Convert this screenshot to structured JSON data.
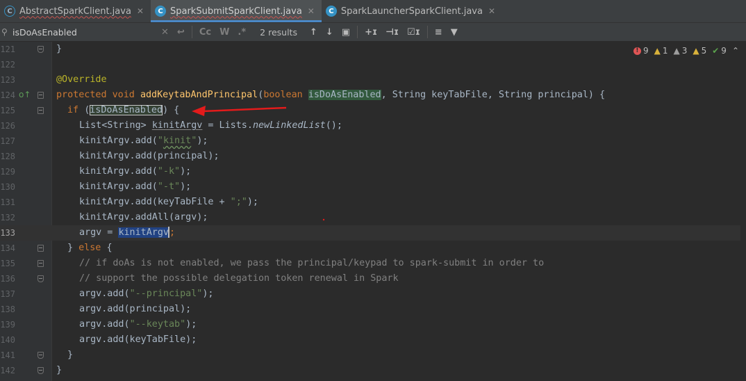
{
  "tabs": [
    {
      "label": "AbstractSparkClient.java",
      "icon": "abstract-class-icon",
      "icon_glyph": "C",
      "active": false
    },
    {
      "label": "SparkSubmitSparkClient.java",
      "icon": "class-icon",
      "icon_glyph": "C",
      "active": true
    },
    {
      "label": "SparkLauncherSparkClient.java",
      "icon": "class-icon",
      "icon_glyph": "C",
      "active": false
    }
  ],
  "search": {
    "value": "isDoAsEnabled",
    "results": "2 results",
    "case_label": "Cc",
    "words_label": "W",
    "regex_label": ".*"
  },
  "indicators": {
    "errors": "9",
    "warnings": "1",
    "weak_warnings": "3",
    "server_problems": "5",
    "typos": "9"
  },
  "code_lines": [
    {
      "num": "121",
      "text": "}"
    },
    {
      "num": "122",
      "text": ""
    },
    {
      "num": "123",
      "text": "@Override"
    },
    {
      "num": "124",
      "text": "protected void addKeytabAndPrincipal(boolean isDoAsEnabled, String keyTabFile, String principal) {"
    },
    {
      "num": "125",
      "text": "if (isDoAsEnabled) {"
    },
    {
      "num": "126",
      "text": "List<String> kinitArgv = Lists.newLinkedList();"
    },
    {
      "num": "127",
      "text": "kinitArgv.add(\"kinit\");"
    },
    {
      "num": "128",
      "text": "kinitArgv.add(principal);"
    },
    {
      "num": "129",
      "text": "kinitArgv.add(\"-k\");"
    },
    {
      "num": "130",
      "text": "kinitArgv.add(\"-t\");"
    },
    {
      "num": "131",
      "text": "kinitArgv.add(keyTabFile + \";\");"
    },
    {
      "num": "132",
      "text": "kinitArgv.addAll(argv);"
    },
    {
      "num": "133",
      "text": "argv = kinitArgv;"
    },
    {
      "num": "134",
      "text": "} else {"
    },
    {
      "num": "135",
      "text": "// if doAs is not enabled, we pass the principal/keypad to spark-submit in order to"
    },
    {
      "num": "136",
      "text": "// support the possible delegation token renewal in Spark"
    },
    {
      "num": "137",
      "text": "argv.add(\"--principal\");"
    },
    {
      "num": "138",
      "text": "argv.add(principal);"
    },
    {
      "num": "139",
      "text": "argv.add(\"--keytab\");"
    },
    {
      "num": "140",
      "text": "argv.add(keyTabFile);"
    },
    {
      "num": "141",
      "text": "}"
    },
    {
      "num": "142",
      "text": "}"
    }
  ],
  "colors": {
    "keyword": "#cc7832",
    "annotation": "#bbb529",
    "method": "#ffc66d",
    "string": "#6a8759",
    "comment": "#808080",
    "identifier": "#a9b7c6",
    "annotation_arrow": "#e31b1b"
  }
}
